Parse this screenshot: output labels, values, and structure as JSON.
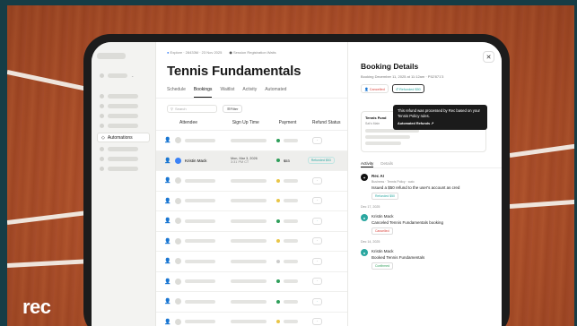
{
  "brand": {
    "logo_text": "rec"
  },
  "colors": {
    "accent_red": "#d9423a",
    "accent_green": "#2f9e5a",
    "accent_teal": "#2aa7a0"
  },
  "app": {
    "breadcrumb": {
      "item1": "Explore · 28433M · 23 Nov 2025",
      "item2": "Session Registration Waits"
    },
    "title": "Tennis Fundamentals",
    "tabs": [
      "Schedule",
      "Bookings",
      "Waitlist",
      "Activity",
      "Automated"
    ],
    "active_tab": "Bookings",
    "search_placeholder": "Search",
    "filter_label": "Filter",
    "sidebar_active": "Automations",
    "table": {
      "headers": [
        "Attendee",
        "Sign Up Time",
        "Payment",
        "Refund Status"
      ],
      "highlight_row": {
        "name": "Kristin Mack",
        "signup": "Mon, Mar 3, 2026",
        "signup_sub": "3:31 PM CT",
        "payment": "$53",
        "refund": "Refunded $53"
      }
    }
  },
  "panel": {
    "title": "Booking Details",
    "subtitle": "Booking December 11, 2025 at 11:12am · P52'871'3",
    "badge_cancelled": "Cancelled",
    "badge_refunded": "Refunded $50",
    "tooltip": "This refund was processed by Rec based on your Tennis Policy rules.",
    "tooltip_link": "Automated Refunds",
    "card_title": "Tennis Fund",
    "card_sub": "Sat's Main",
    "tabs": [
      "Activity",
      "Details"
    ],
    "feed": {
      "rec_ai_name": "Rec AI",
      "rec_ai_meta": "Business · Tennis Policy · auto",
      "rec_ai_text": "Issued a $50 refund to the user's account as cred",
      "rec_ai_tag": "Refunded $50",
      "date1": "Dec 17, 2025",
      "ev1_name": "Kristin Mack",
      "ev1_text": "Canceled Tennis Fundamentals booking",
      "ev1_tag": "Cancelled",
      "date2": "Dec 14, 2025",
      "ev2_name": "Kristin Mack",
      "ev2_text": "Booked Tennis Fundamentals",
      "ev2_tag": "Confirmed"
    }
  }
}
